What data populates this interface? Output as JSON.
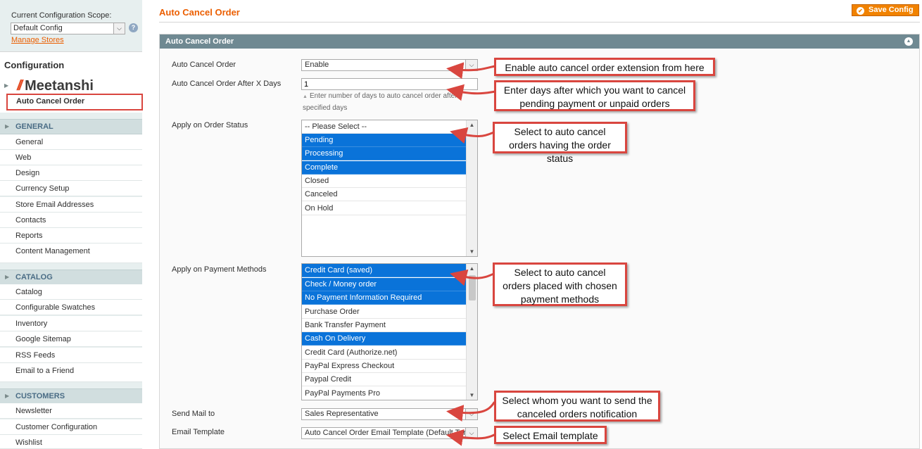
{
  "sidebar": {
    "scope_label": "Current Configuration Scope:",
    "scope_value": "Default Config",
    "manage_stores": "Manage Stores",
    "heading": "Configuration",
    "brand_name": "Meetanshi",
    "brand_item": "Auto Cancel Order",
    "sections": [
      {
        "title": "GENERAL",
        "items": [
          "General",
          "Web",
          "Design",
          "Currency Setup",
          "Store Email Addresses",
          "Contacts",
          "Reports",
          "Content Management"
        ]
      },
      {
        "title": "CATALOG",
        "items": [
          "Catalog",
          "Configurable Swatches",
          "Inventory",
          "Google Sitemap",
          "RSS Feeds",
          "Email to a Friend"
        ]
      },
      {
        "title": "CUSTOMERS",
        "items": [
          "Newsletter",
          "Customer Configuration",
          "Wishlist"
        ]
      }
    ]
  },
  "main": {
    "title": "Auto Cancel Order",
    "save_label": "Save Config",
    "panel_title": "Auto Cancel Order",
    "fields": {
      "auto_cancel": {
        "label": "Auto Cancel Order",
        "value": "Enable"
      },
      "after_days": {
        "label": "Auto Cancel Order After X Days",
        "value": "1",
        "hint": "Enter number of days to auto cancel order after specified days"
      },
      "order_status": {
        "label": "Apply on Order Status",
        "options": [
          {
            "label": "-- Please Select --",
            "selected": false
          },
          {
            "label": "Pending",
            "selected": true
          },
          {
            "label": "Processing",
            "selected": true
          },
          {
            "label": "Complete",
            "selected": true
          },
          {
            "label": "Closed",
            "selected": false
          },
          {
            "label": "Canceled",
            "selected": false
          },
          {
            "label": "On Hold",
            "selected": false
          }
        ]
      },
      "payment_methods": {
        "label": "Apply on Payment Methods",
        "options": [
          {
            "label": "Credit Card (saved)",
            "selected": true
          },
          {
            "label": "Check / Money order",
            "selected": true
          },
          {
            "label": "No Payment Information Required",
            "selected": true
          },
          {
            "label": "Purchase Order",
            "selected": false
          },
          {
            "label": "Bank Transfer Payment",
            "selected": false
          },
          {
            "label": "Cash On Delivery",
            "selected": true
          },
          {
            "label": "Credit Card (Authorize.net)",
            "selected": false
          },
          {
            "label": "PayPal Express Checkout",
            "selected": false
          },
          {
            "label": "Paypal Credit",
            "selected": false
          },
          {
            "label": "PayPal Payments Pro",
            "selected": false
          }
        ]
      },
      "send_mail": {
        "label": "Send Mail to",
        "value": "Sales Representative"
      },
      "email_template": {
        "label": "Email Template",
        "value": "Auto Cancel Order Email Template (Default Template"
      }
    }
  },
  "callouts": {
    "enable": "Enable auto cancel order extension from here",
    "days": "Enter days after which you want to cancel pending payment or unpaid orders",
    "status": "Select to auto cancel orders having the order status",
    "payment": "Select to auto cancel orders placed with chosen payment methods",
    "mail": "Select whom you want to send the canceled orders notification",
    "template": "Select Email template"
  },
  "colors": {
    "accent": "#eb5e00",
    "save_button": "#f18200",
    "panel_header": "#6f8992",
    "selected_option": "#0a73d9",
    "callout_border": "#d9463f",
    "section_text": "#4a6c85"
  }
}
